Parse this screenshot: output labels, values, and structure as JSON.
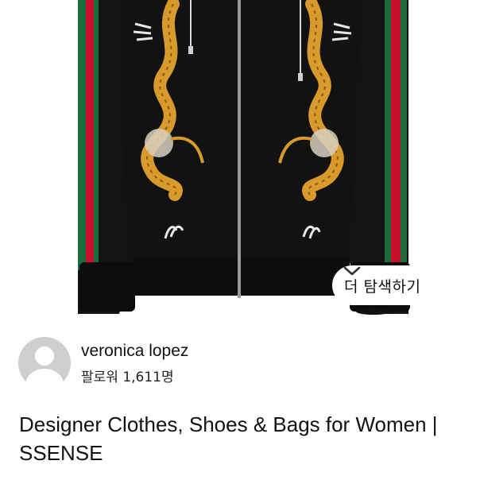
{
  "hero": {
    "alt": "Black zip-up hoodie with embroidered golden dragons and green-red-green striped sleeves"
  },
  "explore": {
    "label": "더 탐색하기",
    "icon": "chevron-down-icon"
  },
  "author": {
    "name": "veronica lopez",
    "followers": "팔로워 1,611명",
    "avatar_icon": "default-user-avatar-icon"
  },
  "pin": {
    "title": "Designer Clothes, Shoes & Bags for Women | SSENSE"
  },
  "colors": {
    "jacket": "#121212",
    "stripe_red": "#c8102e",
    "stripe_green": "#1d6b3a",
    "dragon_gold": "#d89a2a",
    "avatar_bg": "#cfcfcf"
  }
}
